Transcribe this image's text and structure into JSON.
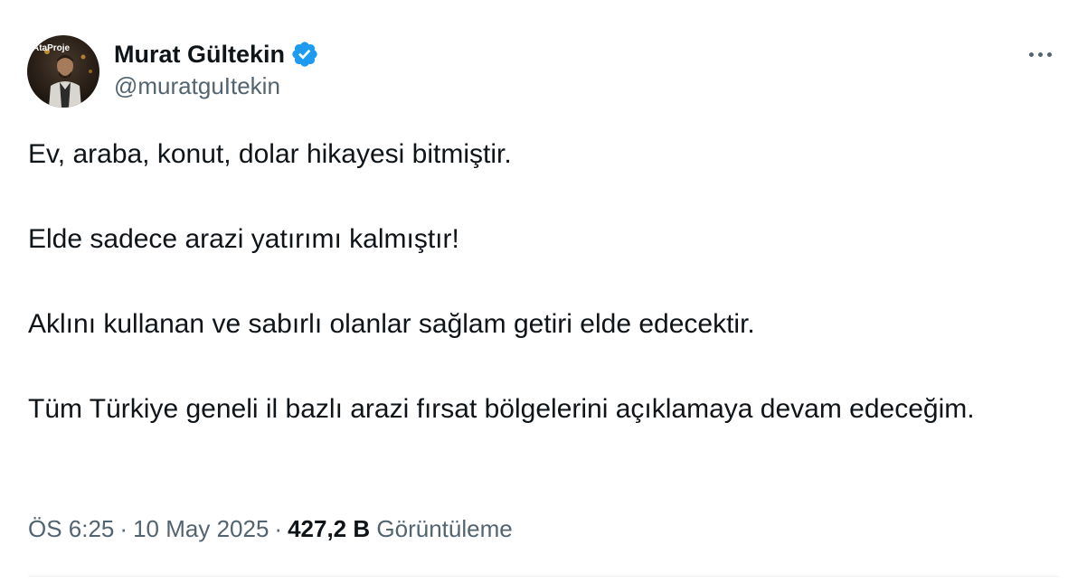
{
  "author": {
    "display_name": "Murat Gültekin",
    "handle": "@muratguItekin",
    "avatar_text": "AtaProje",
    "verified": true
  },
  "tweet": {
    "paragraphs": [
      "Ev, araba, konut, dolar hikayesi bitmiştir.",
      "Elde sadece arazi yatırımı kalmıştır!",
      "Aklını kullanan ve sabırlı olanlar sağlam getiri elde edecektir.",
      "Tüm Türkiye geneli il bazlı arazi fırsat bölgelerini açıklamaya devam edeceğim."
    ]
  },
  "meta": {
    "time": "ÖS 6:25",
    "separator": "·",
    "date": "10 May 2025",
    "views_count": "427,2 B",
    "views_label": "Görüntüleme"
  },
  "colors": {
    "primary_text": "#0f1419",
    "secondary_text": "#536471",
    "verified_badge": "#1d9bf0",
    "divider": "#eff3f4"
  },
  "icons": {
    "verified": "verified-badge-icon",
    "more": "more-options-icon"
  }
}
